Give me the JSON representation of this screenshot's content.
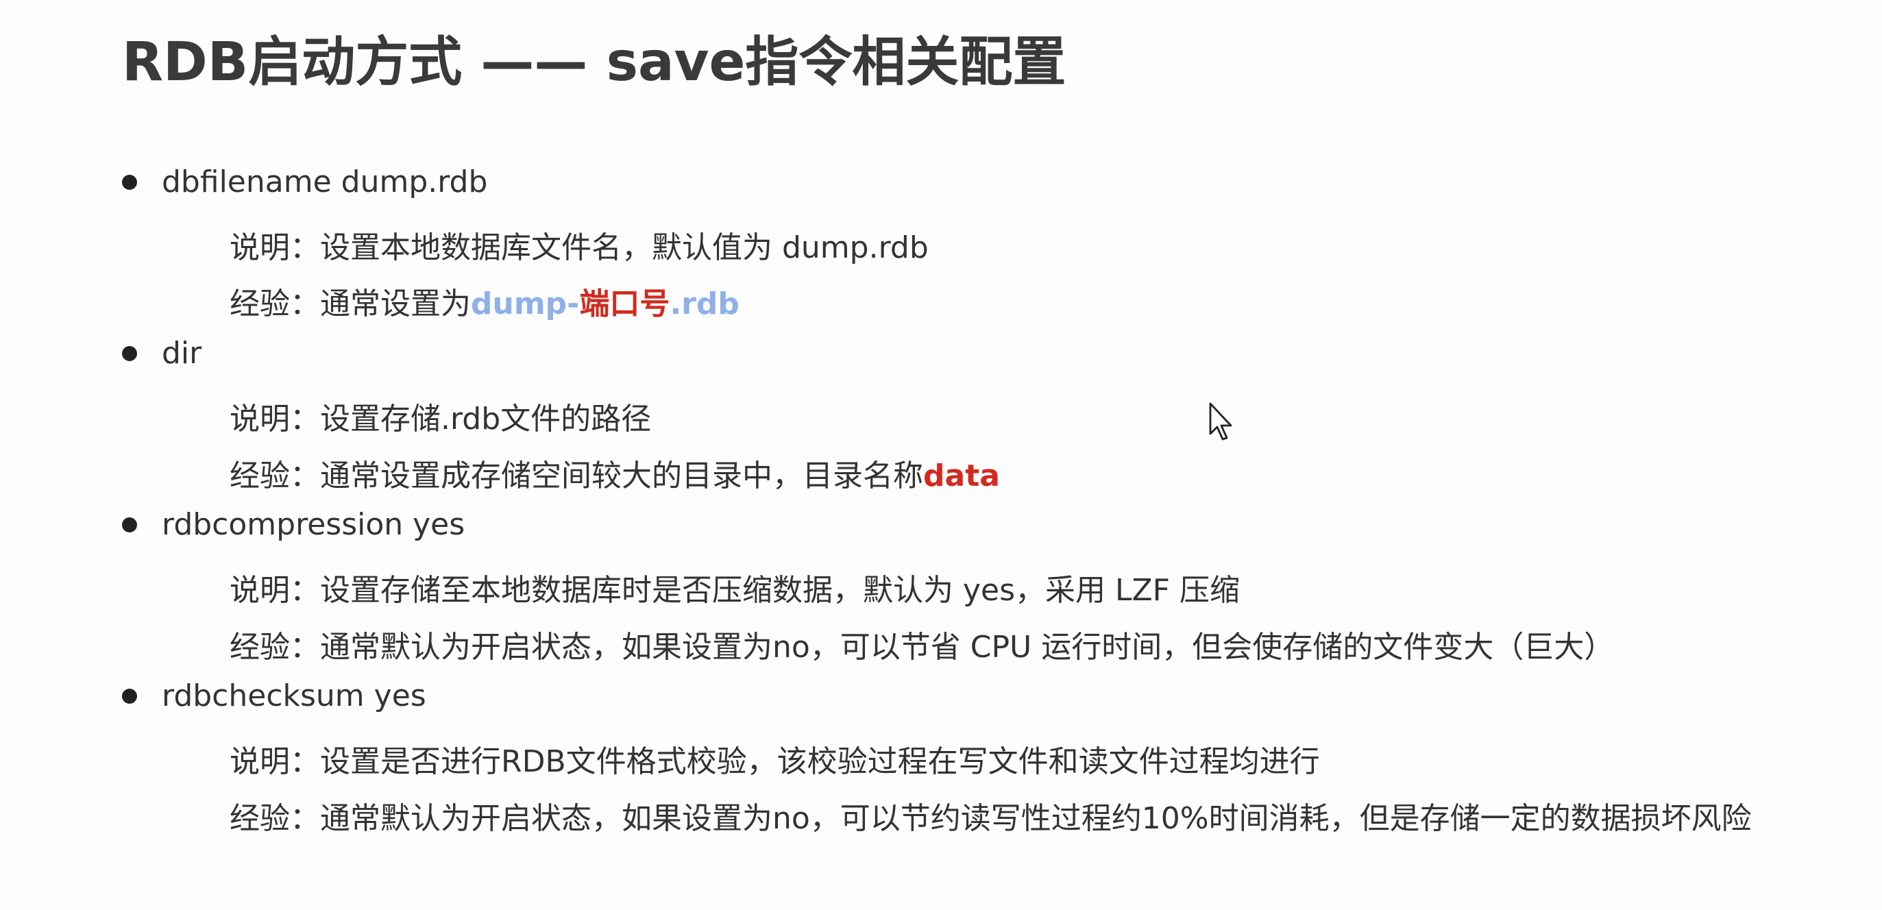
{
  "title": "RDB启动方式 —— save指令相关配置",
  "items": [
    {
      "bullet": "dbfilename dump.rdb",
      "desc_prefix": "说明：",
      "desc_text": "设置本地数据库文件名，默认值为 dump.rdb",
      "exp_prefix": "经验：",
      "exp_text": "通常设置为",
      "exp_hl1": "dump-",
      "exp_hl2": "端口号",
      "exp_hl3": ".rdb"
    },
    {
      "bullet": "dir",
      "desc_prefix": "说明：",
      "desc_text": "设置存储.rdb文件的路径",
      "exp_prefix": "经验：",
      "exp_text": "通常设置成存储空间较大的目录中，目录名称",
      "exp_hl": "data"
    },
    {
      "bullet": "rdbcompression yes",
      "desc_prefix": "说明：",
      "desc_text": "设置存储至本地数据库时是否压缩数据，默认为 yes，采用 LZF 压缩",
      "exp_prefix": "经验：",
      "exp_text": "通常默认为开启状态，如果设置为no，可以节省 CPU 运行时间，但会使存储的文件变大（巨大）"
    },
    {
      "bullet": "rdbchecksum yes",
      "desc_prefix": "说明：",
      "desc_text": "设置是否进行RDB文件格式校验，该校验过程在写文件和读文件过程均进行",
      "exp_prefix": "经验：",
      "exp_text": "通常默认为开启状态，如果设置为no，可以节约读写性过程约10%时间消耗，但是存储一定的数据损坏风险"
    }
  ],
  "colors": {
    "highlight_blue": "#8fb0e8",
    "highlight_red": "#d22a1e"
  },
  "icons": {
    "cursor": "mouse-pointer-icon"
  }
}
